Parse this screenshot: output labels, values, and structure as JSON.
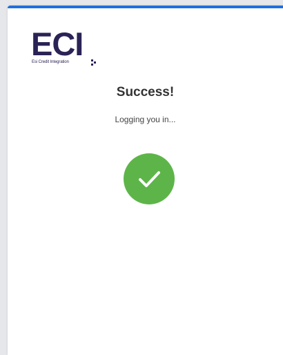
{
  "logo": {
    "wordmark": "ECI",
    "tagline": "Esi Credit Integration",
    "brand_color": "#2a2356"
  },
  "status": {
    "title": "Success!",
    "message": "Logging you in...",
    "icon": "check-circle-icon",
    "success_color": "#5db549"
  },
  "accent_color": "#1e6fe0"
}
